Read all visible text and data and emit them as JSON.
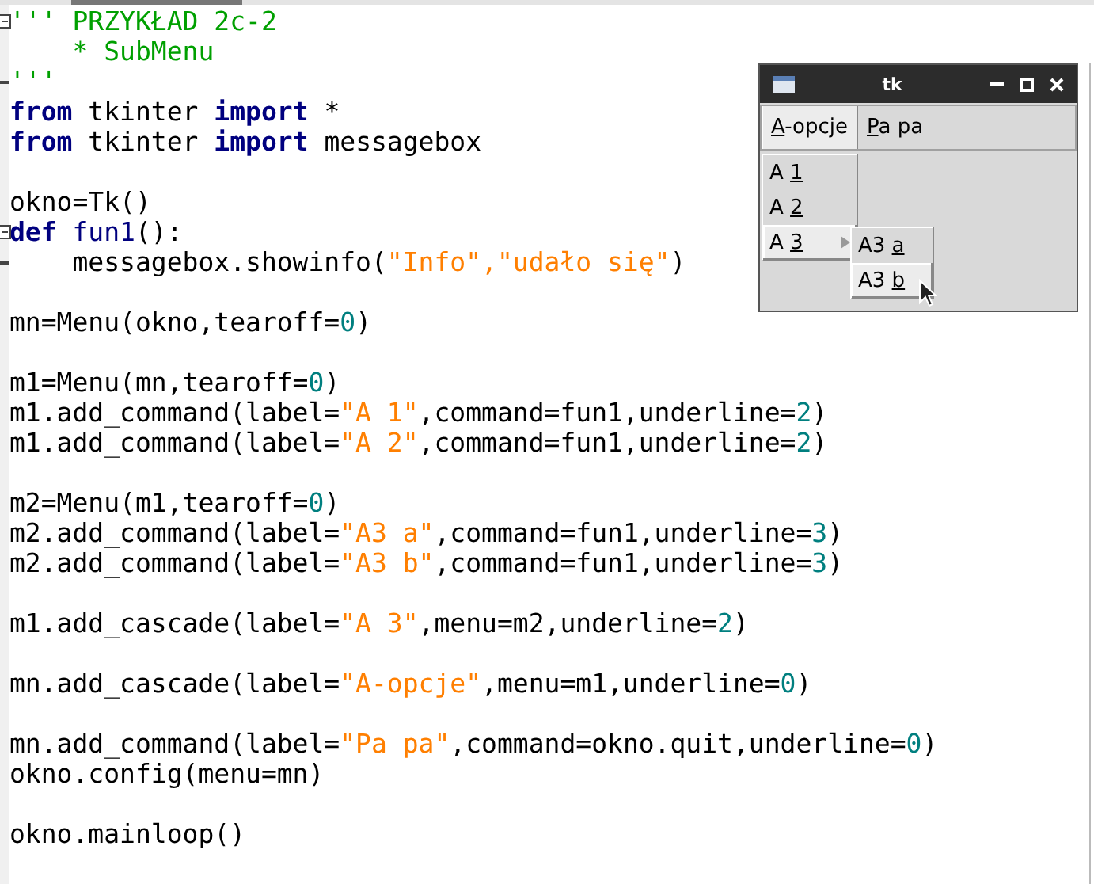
{
  "editor": {
    "blocks": [
      [
        {
          "fold_start": true,
          "tokens": [
            {
              "kind": "doc",
              "t": "''' PRZYKŁAD 2c-2"
            }
          ]
        },
        {
          "tokens": [
            {
              "kind": "doc",
              "t": "    * SubMenu"
            }
          ]
        },
        {
          "fold_end": true,
          "tokens": [
            {
              "kind": "doc",
              "t": "'''"
            }
          ]
        },
        {
          "tokens": [
            {
              "kind": "kw",
              "t": "from"
            },
            {
              "kind": "plain",
              "t": " tkinter "
            },
            {
              "kind": "kw",
              "t": "import"
            },
            {
              "kind": "plain",
              "t": " *"
            }
          ]
        },
        {
          "tokens": [
            {
              "kind": "kw",
              "t": "from"
            },
            {
              "kind": "plain",
              "t": " tkinter "
            },
            {
              "kind": "kw",
              "t": "import"
            },
            {
              "kind": "plain",
              "t": " messagebox"
            }
          ]
        }
      ],
      [
        {
          "tokens": [
            {
              "kind": "plain",
              "t": "okno=Tk()"
            }
          ]
        },
        {
          "fold_start": true,
          "tokens": [
            {
              "kind": "kw",
              "t": "def"
            },
            {
              "kind": "name",
              "t": " fun1"
            },
            {
              "kind": "plain",
              "t": "():"
            }
          ]
        },
        {
          "fold_end": true,
          "tokens": [
            {
              "kind": "plain",
              "t": "    messagebox.showinfo("
            },
            {
              "kind": "str",
              "t": "\"Info\",\"udało się\""
            },
            {
              "kind": "plain",
              "t": ")"
            }
          ]
        }
      ],
      [
        {
          "tokens": [
            {
              "kind": "plain",
              "t": "mn=Menu(okno,tearoff="
            },
            {
              "kind": "num",
              "t": "0"
            },
            {
              "kind": "plain",
              "t": ")"
            }
          ]
        }
      ],
      [
        {
          "tokens": [
            {
              "kind": "plain",
              "t": "m1=Menu(mn,tearoff="
            },
            {
              "kind": "num",
              "t": "0"
            },
            {
              "kind": "plain",
              "t": ")"
            }
          ]
        },
        {
          "tokens": [
            {
              "kind": "plain",
              "t": "m1.add_command(label="
            },
            {
              "kind": "str",
              "t": "\"A 1\""
            },
            {
              "kind": "plain",
              "t": ",command=fun1,underline="
            },
            {
              "kind": "num",
              "t": "2"
            },
            {
              "kind": "plain",
              "t": ")"
            }
          ]
        },
        {
          "tokens": [
            {
              "kind": "plain",
              "t": "m1.add_command(label="
            },
            {
              "kind": "str",
              "t": "\"A 2\""
            },
            {
              "kind": "plain",
              "t": ",command=fun1,underline="
            },
            {
              "kind": "num",
              "t": "2"
            },
            {
              "kind": "plain",
              "t": ")"
            }
          ]
        }
      ],
      [
        {
          "tokens": [
            {
              "kind": "plain",
              "t": "m2=Menu(m1,tearoff="
            },
            {
              "kind": "num",
              "t": "0"
            },
            {
              "kind": "plain",
              "t": ")"
            }
          ]
        },
        {
          "tokens": [
            {
              "kind": "plain",
              "t": "m2.add_command(label="
            },
            {
              "kind": "str",
              "t": "\"A3 a\""
            },
            {
              "kind": "plain",
              "t": ",command=fun1,underline="
            },
            {
              "kind": "num",
              "t": "3"
            },
            {
              "kind": "plain",
              "t": ")"
            }
          ]
        },
        {
          "tokens": [
            {
              "kind": "plain",
              "t": "m2.add_command(label="
            },
            {
              "kind": "str",
              "t": "\"A3 b\""
            },
            {
              "kind": "plain",
              "t": ",command=fun1,underline="
            },
            {
              "kind": "num",
              "t": "3"
            },
            {
              "kind": "plain",
              "t": ")"
            }
          ]
        }
      ],
      [
        {
          "tokens": [
            {
              "kind": "plain",
              "t": "m1.add_cascade(label="
            },
            {
              "kind": "str",
              "t": "\"A 3\""
            },
            {
              "kind": "plain",
              "t": ",menu=m2,underline="
            },
            {
              "kind": "num",
              "t": "2"
            },
            {
              "kind": "plain",
              "t": ")"
            }
          ]
        }
      ],
      [
        {
          "tokens": [
            {
              "kind": "plain",
              "t": "mn.add_cascade(label="
            },
            {
              "kind": "str",
              "t": "\"A-opcje\""
            },
            {
              "kind": "plain",
              "t": ",menu=m1,underline="
            },
            {
              "kind": "num",
              "t": "0"
            },
            {
              "kind": "plain",
              "t": ")"
            }
          ]
        }
      ],
      [
        {
          "tokens": [
            {
              "kind": "plain",
              "t": "mn.add_command(label="
            },
            {
              "kind": "str",
              "t": "\"Pa pa\""
            },
            {
              "kind": "plain",
              "t": ",command=okno.quit,underline="
            },
            {
              "kind": "num",
              "t": "0"
            },
            {
              "kind": "plain",
              "t": ")"
            }
          ]
        },
        {
          "tokens": [
            {
              "kind": "plain",
              "t": "okno.config(menu=mn)"
            }
          ]
        }
      ],
      [
        {
          "tokens": [
            {
              "kind": "plain",
              "t": "okno.mainloop()"
            }
          ]
        }
      ]
    ]
  },
  "tk_window": {
    "title": "tk",
    "menubar": [
      {
        "key": "A",
        "post": "-opcje",
        "selected": true
      },
      {
        "key": "P",
        "post": "a pa",
        "selected": false
      }
    ],
    "menu": [
      {
        "pre": "A ",
        "key": "1",
        "kind": "command",
        "selected": false
      },
      {
        "pre": "A ",
        "key": "2",
        "kind": "command",
        "selected": false
      },
      {
        "pre": "A ",
        "key": "3",
        "kind": "cascade",
        "selected": true
      }
    ],
    "submenu": [
      {
        "pre": "A3 ",
        "key": "a",
        "selected": false
      },
      {
        "pre": "A3 ",
        "key": "b",
        "selected": true
      }
    ]
  }
}
